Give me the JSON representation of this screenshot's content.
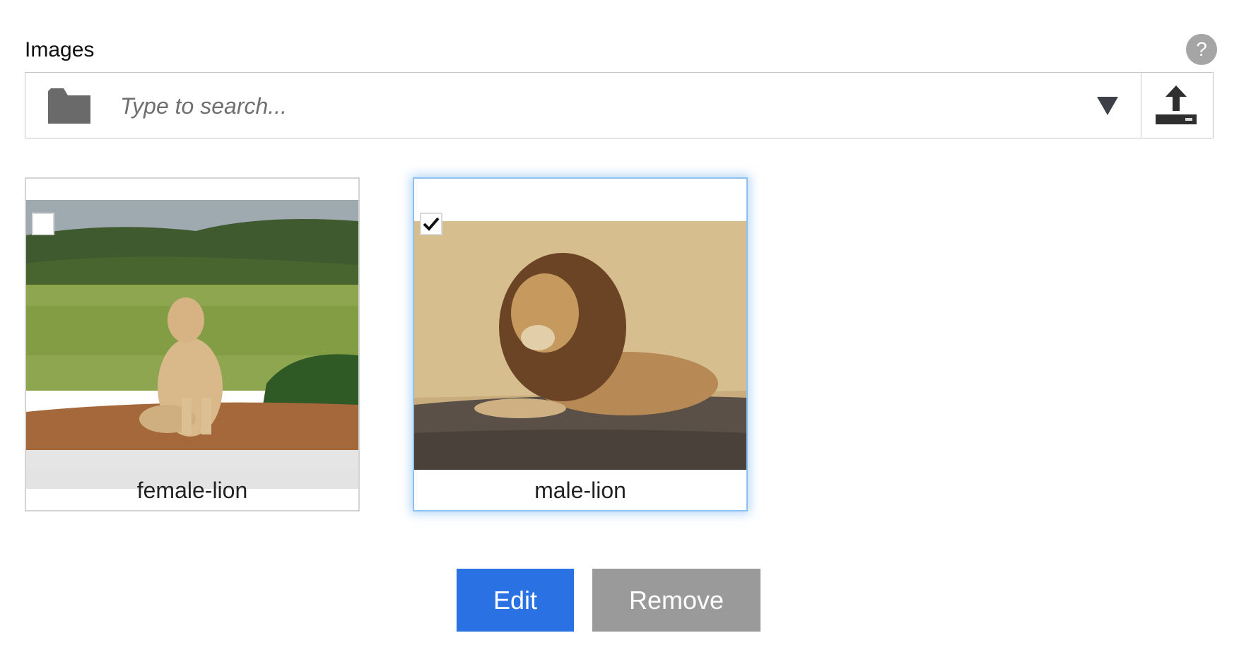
{
  "field": {
    "label": "Images",
    "help_glyph": "?",
    "search_placeholder": "Type to search...",
    "icons": {
      "folder": "folder-icon",
      "dropdown": "dropdown-arrow-icon",
      "upload": "upload-icon"
    }
  },
  "images": [
    {
      "caption": "female-lion",
      "selected": false
    },
    {
      "caption": "male-lion",
      "selected": true
    }
  ],
  "actions": {
    "edit_label": "Edit",
    "remove_label": "Remove"
  },
  "colors": {
    "primary": "#2a72e4",
    "secondary": "#9a9a9a",
    "selection_glow": "#8ec1ef"
  }
}
